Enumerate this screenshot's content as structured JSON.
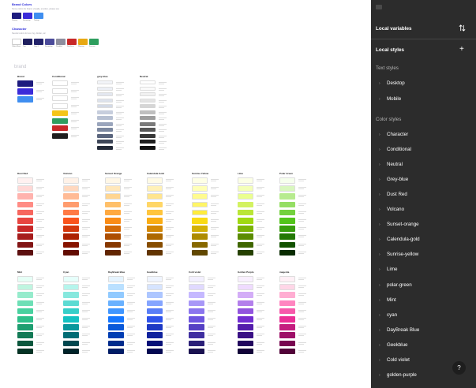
{
  "canvas": {
    "brand_colors": {
      "title": "Brand Colors",
      "subtitle": "Some colors for brand, visually, emotion, please use",
      "labels": [
        "Primary",
        "Secondary",
        "Tertiary"
      ],
      "colors": [
        "#1d1b7e",
        "#3b2bd9",
        "#3f8ef0"
      ]
    },
    "character": {
      "title": "Character",
      "subtitle": "Neutral colors for text, bg, divider, etc",
      "labels": [
        "Colour Base",
        "Text",
        "Grey 1",
        "Secondary",
        "Disabled",
        "Red Error",
        "Warning",
        "Success"
      ],
      "colors": [
        "#ffffff",
        "#1f1f5e",
        "#23236b",
        "#4b4b9a",
        "#8e8e9e",
        "#c82828",
        "#e8a812",
        "#2e9e5e"
      ]
    },
    "brand_tag": "brand",
    "row1_groups": [
      "Brand",
      "Conditional",
      "grey-blue",
      "Neutral"
    ],
    "row2_groups": [
      "Dust Red",
      "Volcano",
      "Sunset Orange",
      "Calendula Gold",
      "Sunrise Yellow",
      "Lime",
      "Polar Green"
    ],
    "row3_groups": [
      "Mint",
      "Cyan",
      "DayBreak Blue",
      "Geekblue",
      "Cold violet",
      "Golden Purple",
      "magenta"
    ],
    "palettes": {
      "brand": [
        "#1d1b7e",
        "#3b2bd9",
        "#3f8ef0"
      ],
      "conditional": [
        "#ffffff",
        "#ffffff",
        "#ffffff",
        "#ffffff",
        "#f5c518",
        "#2e9e5e",
        "#c82828",
        "#1f1f1f"
      ],
      "greyblue": [
        "#f2f4f8",
        "#eceff5",
        "#e3e7ef",
        "#dde2ec",
        "#d4dae6",
        "#c7cedd",
        "#b7c0d2",
        "#9aa5bc",
        "#7b879f",
        "#5b667e",
        "#3d4658",
        "#232a38"
      ],
      "neutral": [
        "#ffffff",
        "#fafafa",
        "#f0f0f0",
        "#e4e4e4",
        "#d6d6d6",
        "#bfbfbf",
        "#9e9e9e",
        "#7a7a7a",
        "#565656",
        "#383838",
        "#1f1f1f",
        "#111111"
      ],
      "dustred": [
        "#fff1f0",
        "#ffd8d6",
        "#ffb3ae",
        "#ff8c85",
        "#f7665e",
        "#e84540",
        "#c82828",
        "#a61c1c",
        "#821515",
        "#5c0f0f"
      ],
      "volcano": [
        "#fff2e8",
        "#ffd8bf",
        "#ffbb96",
        "#ff9c6e",
        "#ff7a45",
        "#fa541c",
        "#d4380d",
        "#ad2102",
        "#871400",
        "#610b00"
      ],
      "sunsetorange": [
        "#fff7e6",
        "#ffe7ba",
        "#ffd591",
        "#ffc069",
        "#ffa940",
        "#fa8c16",
        "#d46b08",
        "#ad4e00",
        "#873800",
        "#612500"
      ],
      "calendulagold": [
        "#fffbe6",
        "#fff1b8",
        "#ffe58f",
        "#ffd666",
        "#ffc53d",
        "#faad14",
        "#d48806",
        "#ad6800",
        "#874d00",
        "#613400"
      ],
      "sunriseyellow": [
        "#feffe6",
        "#ffffb8",
        "#fffb8f",
        "#fff566",
        "#ffec3d",
        "#fadb14",
        "#d4b106",
        "#ad8b00",
        "#876800",
        "#614700"
      ],
      "lime": [
        "#fcffe6",
        "#f4ffb8",
        "#eaff8f",
        "#d3f261",
        "#bae637",
        "#a0d911",
        "#7cb305",
        "#5b8c00",
        "#3f6600",
        "#254000"
      ],
      "polargreen": [
        "#f6ffed",
        "#d9f7be",
        "#b7eb8f",
        "#95de64",
        "#73d13d",
        "#52c41a",
        "#389e0d",
        "#237804",
        "#135200",
        "#092b00"
      ],
      "mint": [
        "#e6fff6",
        "#bff5e0",
        "#96ebcc",
        "#6edfb6",
        "#48d19f",
        "#2ec08a",
        "#1e9e70",
        "#137a56",
        "#0b573d",
        "#053325"
      ],
      "cyan": [
        "#e6fffb",
        "#b5f5ec",
        "#87e8de",
        "#5cdbd3",
        "#36cfc9",
        "#13c2c2",
        "#08979c",
        "#006d75",
        "#00474f",
        "#002329"
      ],
      "daybreakblue": [
        "#e6f4ff",
        "#bae0ff",
        "#91caff",
        "#69b1ff",
        "#4096ff",
        "#1677ff",
        "#0958d9",
        "#003eb3",
        "#002c8c",
        "#001d66"
      ],
      "geekblue": [
        "#f0f5ff",
        "#d6e4ff",
        "#adc6ff",
        "#85a5ff",
        "#597ef7",
        "#2f54eb",
        "#1d39c4",
        "#10239e",
        "#061178",
        "#030852"
      ],
      "coldviolet": [
        "#f3f0ff",
        "#e0d9ff",
        "#c5b8ff",
        "#a897f7",
        "#8b75ee",
        "#6e55e0",
        "#5540c4",
        "#3f2ea0",
        "#2b1f78",
        "#1a1250"
      ],
      "goldenpurple": [
        "#f9f0ff",
        "#efdbff",
        "#d3adf7",
        "#b37feb",
        "#9254de",
        "#722ed1",
        "#531dab",
        "#391085",
        "#22075e",
        "#120338"
      ],
      "magenta": [
        "#fff0f6",
        "#ffd6e7",
        "#ffadd2",
        "#ff85c0",
        "#f759ab",
        "#eb2f96",
        "#c41d7f",
        "#9e1068",
        "#780650",
        "#520339"
      ]
    }
  },
  "panel": {
    "local_variables": "Local variables",
    "local_styles": "Local styles",
    "text_styles": "Text styles",
    "text_items": [
      "Desktop",
      "Mobile"
    ],
    "color_styles": "Color styles",
    "color_items": [
      "Character",
      "Conditional",
      "Neutral",
      "Grey-blue",
      "Dust Red",
      "Volcano",
      "Sunset-orange",
      "Calendula-gold",
      "Sunrise-yellow",
      "Lime",
      "polar-green",
      "Mint",
      "cyan",
      "DayBreak Blue",
      "Geekblue",
      "Cold violet",
      "golden-purple"
    ],
    "help": "?",
    "add_icon": "+",
    "chevron": "›"
  }
}
